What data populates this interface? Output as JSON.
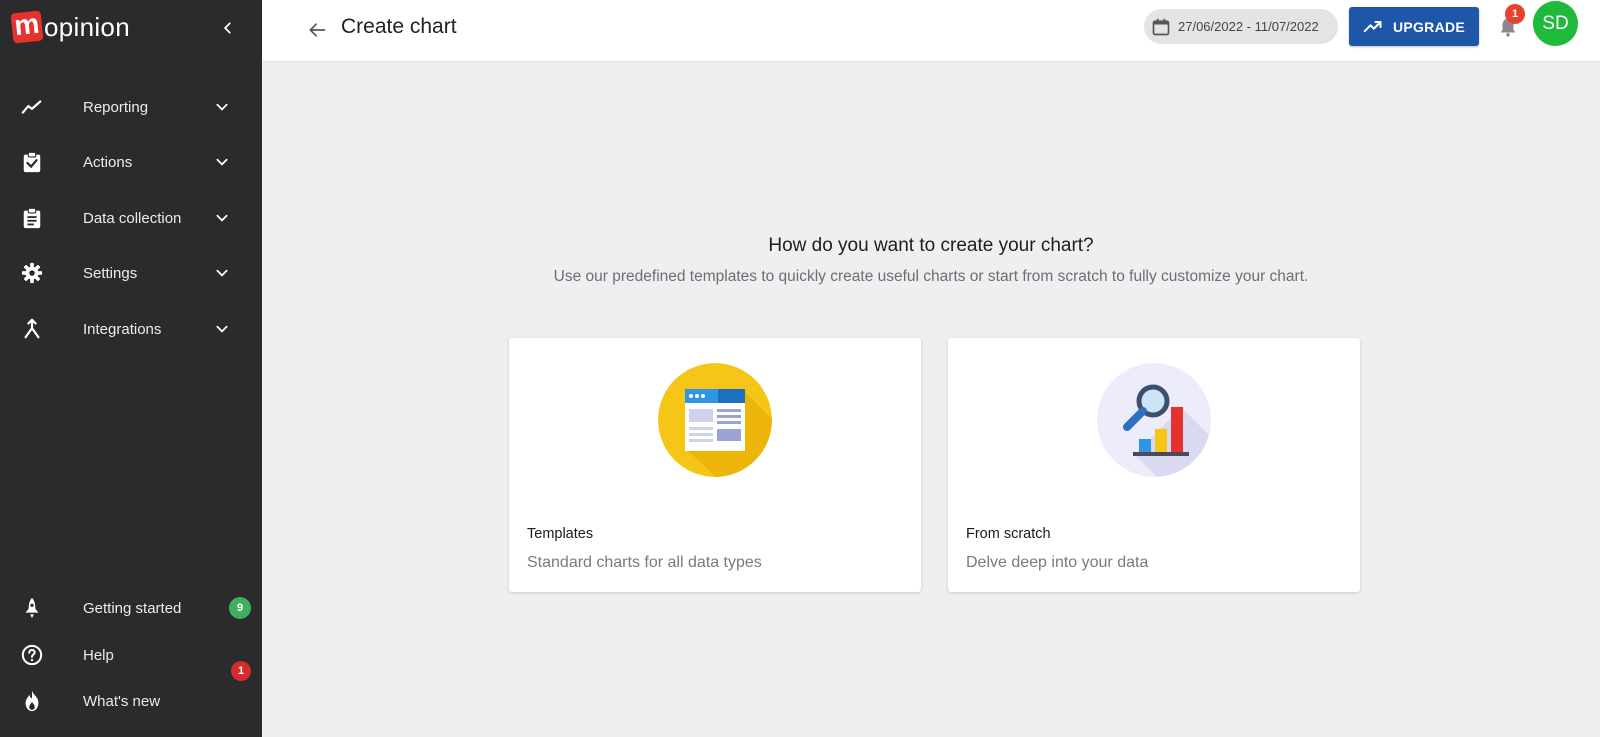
{
  "brand": {
    "name": "opinion",
    "mark": "m"
  },
  "sidebar": {
    "items": [
      {
        "label": "Reporting",
        "icon": "trend-line-icon"
      },
      {
        "label": "Actions",
        "icon": "clipboard-check-icon"
      },
      {
        "label": "Data collection",
        "icon": "clipboard-list-icon"
      },
      {
        "label": "Settings",
        "icon": "gear-icon"
      },
      {
        "label": "Integrations",
        "icon": "merge-icon"
      }
    ],
    "bottom": [
      {
        "label": "Getting started",
        "icon": "rocket-icon",
        "badge": "9",
        "badge_color": "#3fae60"
      },
      {
        "label": "Help",
        "icon": "help-circle-icon"
      },
      {
        "label": "What's new",
        "icon": "flame-icon",
        "badge": "1",
        "badge_color": "#d42c2c"
      }
    ]
  },
  "header": {
    "title": "Create chart",
    "date_range": "27/06/2022 - 11/07/2022",
    "upgrade_label": "UPGRADE",
    "notifications_count": "1",
    "avatar_initials": "SD"
  },
  "main": {
    "question": "How do you want to create your chart?",
    "subtitle": "Use our predefined templates to quickly create useful charts or start from scratch to fully customize your chart.",
    "options": [
      {
        "title": "Templates",
        "description": "Standard charts for all data types",
        "icon": "template-icon"
      },
      {
        "title": "From scratch",
        "description": "Delve deep into your data",
        "icon": "magnifier-chart-icon"
      }
    ]
  },
  "colors": {
    "sidebar_bg": "#2b2b2e",
    "brand_red": "#e5322e",
    "upgrade_blue": "#1e57a7",
    "avatar_green": "#1fba3b",
    "badge_red": "#d42c2c",
    "badge_green": "#3fae60"
  }
}
